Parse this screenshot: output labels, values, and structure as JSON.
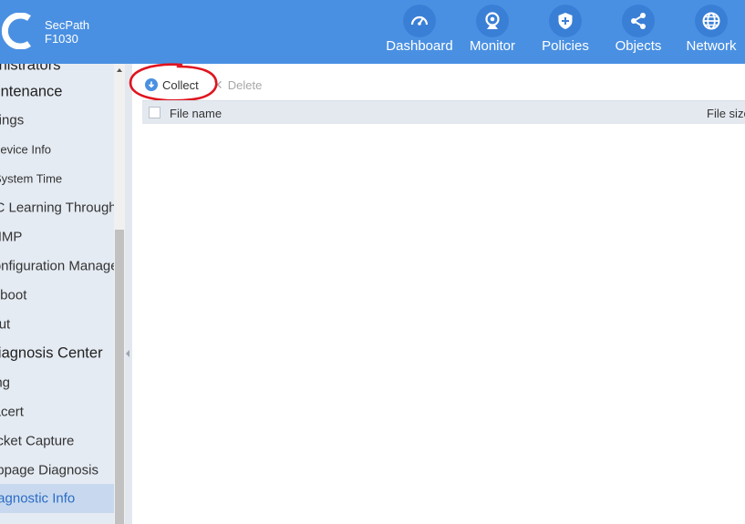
{
  "header": {
    "brand_name": "SecPath",
    "model": "F1030",
    "nav": [
      {
        "label": "Dashboard",
        "icon": "gauge-icon"
      },
      {
        "label": "Monitor",
        "icon": "webcam-icon"
      },
      {
        "label": "Policies",
        "icon": "shield-icon"
      },
      {
        "label": "Objects",
        "icon": "share-icon"
      },
      {
        "label": "Network",
        "icon": "globe-icon"
      }
    ]
  },
  "sidebar": {
    "items": [
      {
        "label": "Administrators",
        "kind": "section"
      },
      {
        "label": "Maintenance",
        "kind": "section"
      },
      {
        "label": "Settings",
        "kind": "item"
      },
      {
        "label": "Device Info",
        "kind": "small"
      },
      {
        "label": "System Time",
        "kind": "small"
      },
      {
        "label": "MAC Learning Through",
        "kind": "item"
      },
      {
        "label": "SNMP",
        "kind": "item"
      },
      {
        "label": "Configuration Manage",
        "kind": "item"
      },
      {
        "label": "Reboot",
        "kind": "item"
      },
      {
        "label": "About",
        "kind": "item"
      },
      {
        "label": "Diagnosis Center",
        "kind": "section"
      },
      {
        "label": "Ping",
        "kind": "item"
      },
      {
        "label": "Tracert",
        "kind": "item"
      },
      {
        "label": "Packet Capture",
        "kind": "item"
      },
      {
        "label": "Webpage Diagnosis",
        "kind": "item"
      },
      {
        "label": "Diagnostic Info",
        "kind": "active"
      }
    ]
  },
  "toolbar": {
    "collect_label": "Collect",
    "delete_label": "Delete"
  },
  "table": {
    "columns": [
      "File name",
      "File size"
    ]
  },
  "colors": {
    "header_bg": "#4a90e2",
    "sidebar_bg": "#e5ebf3",
    "active_text": "#2b6cc4",
    "annotation": "#e0141e"
  }
}
